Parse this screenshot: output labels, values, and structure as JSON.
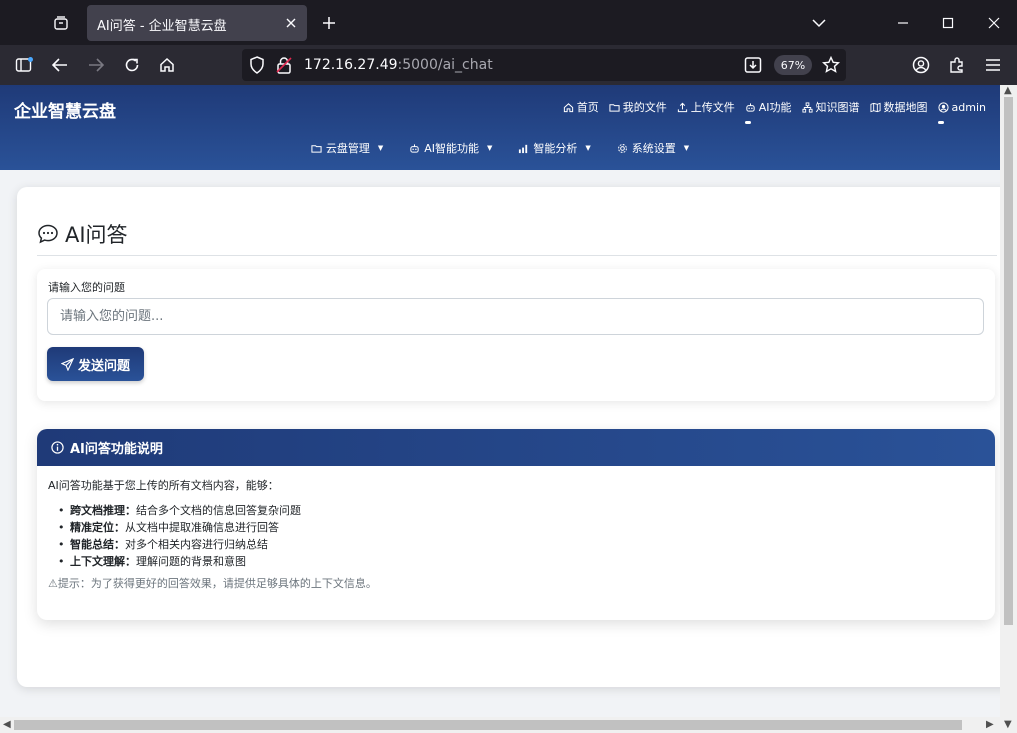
{
  "browser": {
    "tab_title": "AI问答 - 企业智慧云盘",
    "url_host": "172.16.27.49",
    "url_rest": ":5000/ai_chat",
    "zoom": "67%"
  },
  "site": {
    "brand": "企业智慧云盘",
    "topnav": [
      {
        "label": "首页",
        "icon": "home-icon"
      },
      {
        "label": "我的文件",
        "icon": "folder-icon"
      },
      {
        "label": "上传文件",
        "icon": "upload-icon"
      },
      {
        "label": "AI功能",
        "icon": "robot-icon"
      },
      {
        "label": "知识图谱",
        "icon": "diagram-icon"
      },
      {
        "label": "数据地图",
        "icon": "map-icon"
      },
      {
        "label": "admin",
        "icon": "user-circle-icon"
      }
    ],
    "subnav": [
      {
        "label": "云盘管理",
        "icon": "folder-icon"
      },
      {
        "label": "AI智能功能",
        "icon": "robot-icon"
      },
      {
        "label": "智能分析",
        "icon": "bar-chart-icon"
      },
      {
        "label": "系统设置",
        "icon": "gear-icon"
      }
    ]
  },
  "page": {
    "title": "AI问答",
    "ask": {
      "label": "请输入您的问题",
      "placeholder": "请输入您的问题...",
      "send_label": "发送问题"
    },
    "info": {
      "heading": "AI问答功能说明",
      "intro": "AI问答功能基于您上传的所有文档内容，能够：",
      "items": [
        {
          "term": "跨文档推理：",
          "desc": "结合多个文档的信息回答复杂问题"
        },
        {
          "term": "精准定位：",
          "desc": "从文档中提取准确信息进行回答"
        },
        {
          "term": "智能总结：",
          "desc": "对多个相关内容进行归纳总结"
        },
        {
          "term": "上下文理解：",
          "desc": "理解问题的背景和意图"
        }
      ],
      "tip": "提示：为了获得更好的回答效果，请提供足够具体的上下文信息。"
    }
  },
  "colors": {
    "header_dark": "#1f3a78",
    "header_light": "#2a5298"
  }
}
